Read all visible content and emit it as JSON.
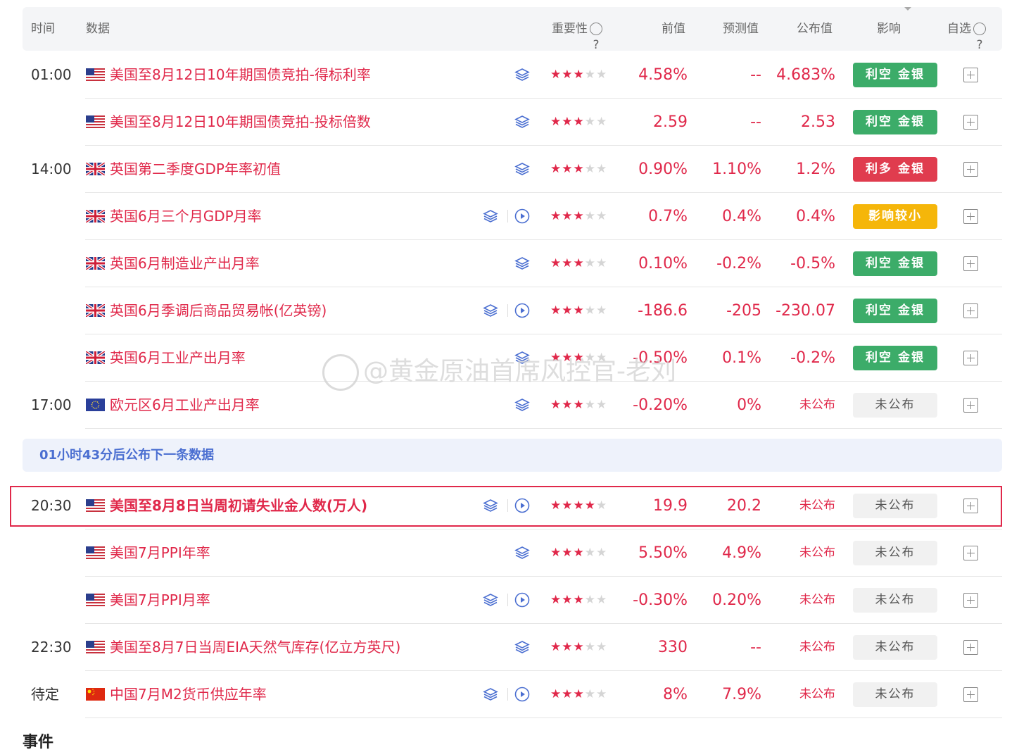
{
  "header": {
    "time": "时间",
    "data": "数据",
    "importance": "重要性",
    "previous": "前值",
    "forecast": "预测值",
    "actual": "公布值",
    "impact": "影响",
    "watchlist": "自选"
  },
  "icons": {
    "help": "help-circle-icon",
    "layers": "layers-icon",
    "play": "play-circle-icon",
    "add": "plus-square-icon"
  },
  "colors": {
    "accent_red": "#e0284a",
    "bearish_green": "#3cac69",
    "bullish_red": "#e03c4e",
    "minor_yellow": "#f5b60a",
    "notice_blue": "#4b6fd1"
  },
  "rows": [
    {
      "time": "01:00",
      "flag": "us",
      "name": "美国至8月12日10年期国债竞拍-得标利率",
      "play": false,
      "stars": 3,
      "prev": "4.58%",
      "forecast": "--",
      "actual": "4.683%",
      "impact": "利空 金银",
      "impact_type": "green"
    },
    {
      "time": "",
      "flag": "us",
      "name": "美国至8月12日10年期国债竞拍-投标倍数",
      "play": false,
      "stars": 3,
      "prev": "2.59",
      "forecast": "--",
      "actual": "2.53",
      "impact": "利空 金银",
      "impact_type": "green"
    },
    {
      "time": "14:00",
      "flag": "uk",
      "name": "英国第二季度GDP年率初值",
      "play": false,
      "stars": 3,
      "prev": "0.90%",
      "forecast": "1.10%",
      "actual": "1.2%",
      "impact": "利多 金银",
      "impact_type": "red"
    },
    {
      "time": "",
      "flag": "uk",
      "name": "英国6月三个月GDP月率",
      "play": true,
      "stars": 3,
      "prev": "0.7%",
      "forecast": "0.4%",
      "actual": "0.4%",
      "impact": "影响较小",
      "impact_type": "yellow"
    },
    {
      "time": "",
      "flag": "uk",
      "name": "英国6月制造业产出月率",
      "play": false,
      "stars": 3,
      "prev": "0.10%",
      "forecast": "-0.2%",
      "actual": "-0.5%",
      "impact": "利空 金银",
      "impact_type": "green"
    },
    {
      "time": "",
      "flag": "uk",
      "name": "英国6月季调后商品贸易帐(亿英镑)",
      "play": true,
      "stars": 3,
      "prev": "-186.6",
      "forecast": "-205",
      "actual": "-230.07",
      "impact": "利空 金银",
      "impact_type": "green"
    },
    {
      "time": "",
      "flag": "uk",
      "name": "英国6月工业产出月率",
      "play": false,
      "stars": 3,
      "prev": "-0.50%",
      "forecast": "0.1%",
      "actual": "-0.2%",
      "impact": "利空 金银",
      "impact_type": "green"
    },
    {
      "time": "17:00",
      "flag": "eu",
      "name": "欧元区6月工业产出月率",
      "play": false,
      "stars": 3,
      "prev": "-0.20%",
      "forecast": "0%",
      "actual": "未公布",
      "impact": "未公布",
      "impact_type": "gray"
    },
    {
      "time": "20:30",
      "flag": "us",
      "name": "美国至8月8日当周初请失业金人数(万人)",
      "play": true,
      "stars": 4,
      "prev": "19.9",
      "forecast": "20.2",
      "actual": "未公布",
      "impact": "未公布",
      "impact_type": "gray",
      "bold": true
    },
    {
      "time": "",
      "flag": "us",
      "name": "美国7月PPI年率",
      "play": false,
      "stars": 3,
      "prev": "5.50%",
      "forecast": "4.9%",
      "actual": "未公布",
      "impact": "未公布",
      "impact_type": "gray"
    },
    {
      "time": "",
      "flag": "us",
      "name": "美国7月PPI月率",
      "play": true,
      "stars": 3,
      "prev": "-0.30%",
      "forecast": "0.20%",
      "actual": "未公布",
      "impact": "未公布",
      "impact_type": "gray"
    },
    {
      "time": "22:30",
      "flag": "us",
      "name": "美国至8月7日当周EIA天然气库存(亿立方英尺)",
      "play": false,
      "stars": 3,
      "prev": "330",
      "forecast": "--",
      "actual": "未公布",
      "impact": "未公布",
      "impact_type": "gray"
    },
    {
      "time": "待定",
      "flag": "cn",
      "name": "中国7月M2货币供应年率",
      "play": true,
      "stars": 3,
      "prev": "8%",
      "forecast": "7.9%",
      "actual": "未公布",
      "impact": "未公布",
      "impact_type": "gray"
    }
  ],
  "notice": "01小时43分后公布下一条数据",
  "watermark": "@黄金原油首席风控官-老刘",
  "footer_title": "事件"
}
